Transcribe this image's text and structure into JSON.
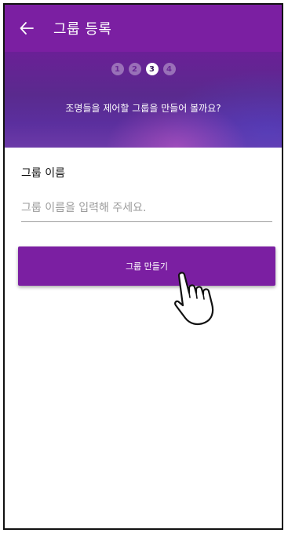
{
  "appbar": {
    "back_icon": "arrow-left-icon",
    "title": "그룹 등록"
  },
  "stepper": {
    "steps": [
      "1",
      "2",
      "3",
      "4"
    ],
    "current": 3
  },
  "hero": {
    "subtitle": "조명들을 제어할 그룹을 만들어 볼까요?"
  },
  "form": {
    "group_name_label": "그룹 이름",
    "group_name_placeholder": "그룹 이름을 입력해 주세요.",
    "group_name_value": ""
  },
  "actions": {
    "create_label": "그룹 만들기"
  },
  "colors": {
    "primary": "#7b1fa2",
    "hero_dark": "#5a2a8e"
  },
  "overlay": {
    "pointer_icon": "hand-pointer-icon"
  }
}
